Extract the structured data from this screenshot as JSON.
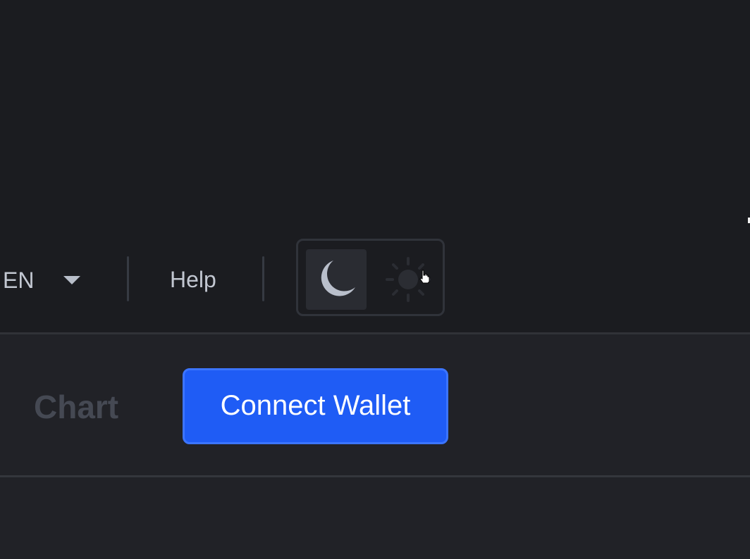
{
  "header": {
    "language": {
      "value": "EN",
      "icon": "chevron-down-icon"
    },
    "help_label": "Help",
    "theme_toggle": {
      "selected": "dark",
      "options": [
        {
          "name": "dark",
          "icon": "moon-icon"
        },
        {
          "name": "light",
          "icon": "sun-icon"
        }
      ]
    }
  },
  "toolbar": {
    "chart_label": "Chart",
    "connect_wallet_label": "Connect Wallet"
  },
  "colors": {
    "background": "#1b1c20",
    "panel": "#212227",
    "accent": "#1f5cf5",
    "muted_text": "#454953",
    "text": "#c2c7d1"
  }
}
